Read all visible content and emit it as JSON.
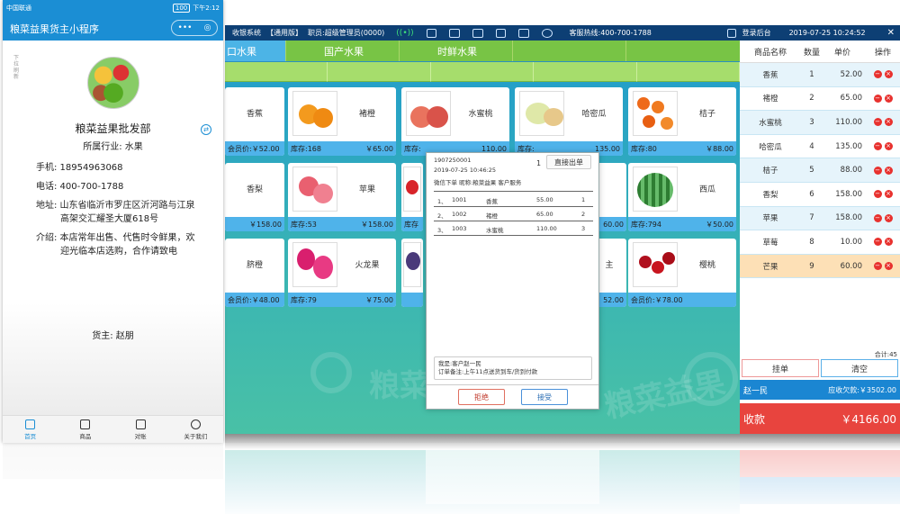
{
  "pos": {
    "topbar": {
      "system": "收银系统",
      "edition": "【通用版】",
      "staff": "职员:超级管理员(0000)",
      "hotline": "客服热线:400-700-1788",
      "login_back": "登录后台",
      "datetime": "2019-07-25  10:24:52",
      "close": "✕"
    },
    "categories": [
      "口水果",
      "国产水果",
      "时鲜水果",
      "",
      ""
    ],
    "products": [
      {
        "name": "香蕉",
        "stock": "会员价:￥52.00",
        "price": ""
      },
      {
        "name": "褚橙",
        "stock": "库存:168",
        "price": "￥65.00"
      },
      {
        "name": "水蜜桃",
        "stock": "库存:",
        "price": "110.00"
      },
      {
        "name": "哈密瓜",
        "stock": "库存:",
        "price": "135.00"
      },
      {
        "name": "桔子",
        "stock": "库存:80",
        "price": "￥88.00"
      },
      {
        "name": "香梨",
        "stock": "",
        "price": "￥158.00"
      },
      {
        "name": "苹果",
        "stock": "库存:53",
        "price": "￥158.00"
      },
      {
        "name": "",
        "stock": "库存",
        "price": ""
      },
      {
        "name": "",
        "stock": "",
        "price": "60.00"
      },
      {
        "name": "西瓜",
        "stock": "库存:794",
        "price": "￥50.00"
      },
      {
        "name": "脐橙",
        "stock": "会员价:￥48.00",
        "price": ""
      },
      {
        "name": "火龙果",
        "stock": "库存:79",
        "price": "￥75.00"
      },
      {
        "name": "",
        "stock": "",
        "price": ""
      },
      {
        "name": "",
        "stock": "",
        "price": "52.00"
      },
      {
        "name": "樱桃",
        "stock": "会员价:￥78.00",
        "price": ""
      }
    ],
    "dialog": {
      "order_no": "1907250001",
      "qty_badge": "1",
      "direct_out": "直接出单",
      "time": "2019-07-25 10:46:25",
      "info": "微信下单  昵称:粮菜益果  客户服务",
      "items": [
        {
          "idx": "1、",
          "code": "1001",
          "name": "香蕉",
          "price": "55.00",
          "qty": "1"
        },
        {
          "idx": "2、",
          "code": "1002",
          "name": "褚橙",
          "price": "65.00",
          "qty": "2"
        },
        {
          "idx": "3、",
          "code": "1003",
          "name": "水蜜桃",
          "price": "110.00",
          "qty": "3"
        }
      ],
      "note_line1": "我是:客户赵一民",
      "note_line2": "订单备注:上午11点送货到车/货到付款",
      "reject": "拒绝",
      "accept": "接受"
    },
    "order": {
      "headers": [
        "商品名称",
        "数量",
        "单价",
        "操作"
      ],
      "rows": [
        {
          "name": "香蕉",
          "qty": "1",
          "price": "52.00"
        },
        {
          "name": "褚橙",
          "qty": "2",
          "price": "65.00"
        },
        {
          "name": "水蜜桃",
          "qty": "3",
          "price": "110.00"
        },
        {
          "name": "哈密瓜",
          "qty": "4",
          "price": "135.00"
        },
        {
          "name": "桔子",
          "qty": "5",
          "price": "88.00"
        },
        {
          "name": "香梨",
          "qty": "6",
          "price": "158.00"
        },
        {
          "name": "苹果",
          "qty": "7",
          "price": "158.00"
        },
        {
          "name": "草莓",
          "qty": "8",
          "price": "10.00"
        },
        {
          "name": "芒果",
          "qty": "9",
          "price": "60.00"
        }
      ],
      "total_count": "合计:45",
      "hold": "挂单",
      "clear": "清空",
      "customer": "赵一民",
      "receivable": "应收欠款:￥3502.00",
      "pay_label": "收款",
      "pay_amount": "￥4166.00"
    },
    "watermark": "粮菜益果",
    "colors": {
      "accent": "#1b86d2",
      "pay": "#e8443e",
      "cat_green": "#78c445",
      "top": "#0d3f74"
    }
  },
  "phone": {
    "carrier": "中国联通",
    "battery": "100",
    "time": "下午2:12",
    "title": "粮菜益果货主小程序",
    "capsule_dots": "•••",
    "capsule_target": "◎",
    "pull_hint": "下拉刷新",
    "shop_name": "粮菜益果批发部",
    "industry": "所属行业: 水果",
    "mobile": "手机: 18954963068",
    "phone": "电话: 400-700-1788",
    "address_l1": "地址: 山东省临沂市罗庄区沂河路与江泉",
    "address_l2": "高架交汇耀圣大厦618号",
    "intro_l1": "介绍: 本店常年出售、代售时令鲜果，欢",
    "intro_l2": "迎光临本店选购，合作请致电",
    "owner": "货主: 赵朋",
    "tabs": [
      "首页",
      "商品",
      "对账",
      "关于我们"
    ]
  }
}
